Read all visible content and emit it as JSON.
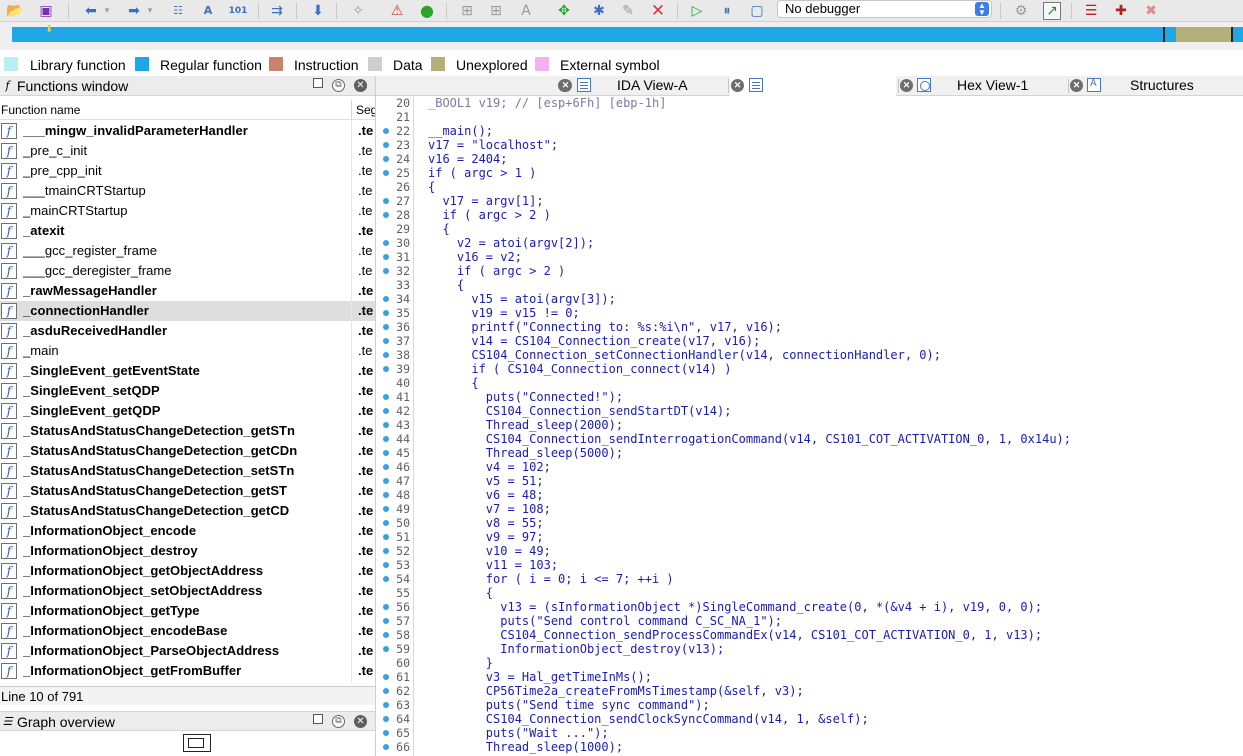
{
  "toolbar": {
    "debugger_select": "No debugger",
    "icons": [
      "open-icon",
      "save-icon",
      "back-icon",
      "forward-icon",
      "binary-icon",
      "text-icon",
      "hex-icon",
      "jump-icon",
      "download-icon",
      "search-icon",
      "warning-icon",
      "run-icon",
      "plus-icon",
      "graph-icon",
      "text-plus-icon",
      "tool-icon",
      "gear-icon",
      "edit-icon",
      "close-red-icon",
      "play-icon",
      "pause-icon",
      "stop-icon",
      "debug-icon",
      "terminal-icon",
      "stack-icon",
      "breakpoint-icon",
      "clear-breakpoint-icon"
    ]
  },
  "legend": [
    {
      "label": "Library function",
      "color": "#b7f0f4"
    },
    {
      "label": "Regular function",
      "color": "#1ea6e6"
    },
    {
      "label": "Instruction",
      "color": "#c9836a"
    },
    {
      "label": "Data",
      "color": "#cfcfcf"
    },
    {
      "label": "Unexplored",
      "color": "#b5b07a"
    },
    {
      "label": "External symbol",
      "color": "#f4b0f0"
    }
  ],
  "functions_window": {
    "title": "Functions window",
    "col_name": "Function name",
    "col_seg": "Seg",
    "selected_index": 9,
    "functions": [
      {
        "name": "___mingw_invalidParameterHandler",
        "seg": ".te",
        "bold": true
      },
      {
        "name": "_pre_c_init",
        "seg": ".te",
        "bold": false
      },
      {
        "name": "_pre_cpp_init",
        "seg": ".te",
        "bold": false
      },
      {
        "name": "___tmainCRTStartup",
        "seg": ".te",
        "bold": false
      },
      {
        "name": "_mainCRTStartup",
        "seg": ".te",
        "bold": false
      },
      {
        "name": "_atexit",
        "seg": ".te",
        "bold": true
      },
      {
        "name": "___gcc_register_frame",
        "seg": ".te",
        "bold": false
      },
      {
        "name": "___gcc_deregister_frame",
        "seg": ".te",
        "bold": false
      },
      {
        "name": "_rawMessageHandler",
        "seg": ".te",
        "bold": true
      },
      {
        "name": "_connectionHandler",
        "seg": ".te",
        "bold": true
      },
      {
        "name": "_asduReceivedHandler",
        "seg": ".te",
        "bold": true
      },
      {
        "name": "_main",
        "seg": ".te",
        "bold": false
      },
      {
        "name": "_SingleEvent_getEventState",
        "seg": ".te",
        "bold": true
      },
      {
        "name": "_SingleEvent_setQDP",
        "seg": ".te",
        "bold": true
      },
      {
        "name": "_SingleEvent_getQDP",
        "seg": ".te",
        "bold": true
      },
      {
        "name": "_StatusAndStatusChangeDetection_getSTn",
        "seg": ".te",
        "bold": true
      },
      {
        "name": "_StatusAndStatusChangeDetection_getCDn",
        "seg": ".te",
        "bold": true
      },
      {
        "name": "_StatusAndStatusChangeDetection_setSTn",
        "seg": ".te",
        "bold": true
      },
      {
        "name": "_StatusAndStatusChangeDetection_getST",
        "seg": ".te",
        "bold": true
      },
      {
        "name": "_StatusAndStatusChangeDetection_getCD",
        "seg": ".te",
        "bold": true
      },
      {
        "name": "_InformationObject_encode",
        "seg": ".te",
        "bold": true
      },
      {
        "name": "_InformationObject_destroy",
        "seg": ".te",
        "bold": true
      },
      {
        "name": "_InformationObject_getObjectAddress",
        "seg": ".te",
        "bold": true
      },
      {
        "name": "_InformationObject_setObjectAddress",
        "seg": ".te",
        "bold": true
      },
      {
        "name": "_InformationObject_getType",
        "seg": ".te",
        "bold": true
      },
      {
        "name": "_InformationObject_encodeBase",
        "seg": ".te",
        "bold": true
      },
      {
        "name": "_InformationObject_ParseObjectAddress",
        "seg": ".te",
        "bold": true
      },
      {
        "name": "_InformationObject_getFromBuffer",
        "seg": ".te",
        "bold": true
      }
    ],
    "status": "Line 10 of 791"
  },
  "graph_overview": {
    "title": "Graph overview"
  },
  "tabs": [
    {
      "label": "IDA View-A",
      "active": false,
      "icon": "ida-view-icon"
    },
    {
      "label": "",
      "active": true,
      "icon": "pseudocode-icon"
    },
    {
      "label": "Hex View-1",
      "active": false,
      "icon": "hex-view-icon"
    },
    {
      "label": "Structures",
      "active": false,
      "icon": "structures-icon"
    }
  ],
  "code_lines": [
    {
      "n": "20",
      "dot": false,
      "text": "_BOOL1 v19; // [esp+6Fh] [ebp-1h]"
    },
    {
      "n": "21",
      "dot": false,
      "text": ""
    },
    {
      "n": "22",
      "dot": true,
      "text": "__main();"
    },
    {
      "n": "23",
      "dot": true,
      "text": "v17 = \"localhost\";"
    },
    {
      "n": "24",
      "dot": true,
      "text": "v16 = 2404;"
    },
    {
      "n": "25",
      "dot": true,
      "text": "if ( argc > 1 )"
    },
    {
      "n": "26",
      "dot": false,
      "text": "{"
    },
    {
      "n": "27",
      "dot": true,
      "text": "  v17 = argv[1];"
    },
    {
      "n": "28",
      "dot": true,
      "text": "  if ( argc > 2 )"
    },
    {
      "n": "29",
      "dot": false,
      "text": "  {"
    },
    {
      "n": "30",
      "dot": true,
      "text": "    v2 = atoi(argv[2]);"
    },
    {
      "n": "31",
      "dot": true,
      "text": "    v16 = v2;"
    },
    {
      "n": "32",
      "dot": true,
      "text": "    if ( argc > 2 )"
    },
    {
      "n": "33",
      "dot": false,
      "text": "    {"
    },
    {
      "n": "34",
      "dot": true,
      "text": "      v15 = atoi(argv[3]);"
    },
    {
      "n": "35",
      "dot": true,
      "text": "      v19 = v15 != 0;"
    },
    {
      "n": "36",
      "dot": true,
      "text": "      printf(\"Connecting to: %s:%i\\n\", v17, v16);"
    },
    {
      "n": "37",
      "dot": true,
      "text": "      v14 = CS104_Connection_create(v17, v16);"
    },
    {
      "n": "38",
      "dot": true,
      "text": "      CS104_Connection_setConnectionHandler(v14, connectionHandler, 0);"
    },
    {
      "n": "39",
      "dot": true,
      "text": "      if ( CS104_Connection_connect(v14) )"
    },
    {
      "n": "40",
      "dot": false,
      "text": "      {"
    },
    {
      "n": "41",
      "dot": true,
      "text": "        puts(\"Connected!\");"
    },
    {
      "n": "42",
      "dot": true,
      "text": "        CS104_Connection_sendStartDT(v14);"
    },
    {
      "n": "43",
      "dot": true,
      "text": "        Thread_sleep(2000);"
    },
    {
      "n": "44",
      "dot": true,
      "text": "        CS104_Connection_sendInterrogationCommand(v14, CS101_COT_ACTIVATION_0, 1, 0x14u);"
    },
    {
      "n": "45",
      "dot": true,
      "text": "        Thread_sleep(5000);"
    },
    {
      "n": "46",
      "dot": true,
      "text": "        v4 = 102;"
    },
    {
      "n": "47",
      "dot": true,
      "text": "        v5 = 51;"
    },
    {
      "n": "48",
      "dot": true,
      "text": "        v6 = 48;"
    },
    {
      "n": "49",
      "dot": true,
      "text": "        v7 = 108;"
    },
    {
      "n": "50",
      "dot": true,
      "text": "        v8 = 55;"
    },
    {
      "n": "51",
      "dot": true,
      "text": "        v9 = 97;"
    },
    {
      "n": "52",
      "dot": true,
      "text": "        v10 = 49;"
    },
    {
      "n": "53",
      "dot": true,
      "text": "        v11 = 103;"
    },
    {
      "n": "54",
      "dot": true,
      "text": "        for ( i = 0; i <= 7; ++i )"
    },
    {
      "n": "55",
      "dot": false,
      "text": "        {"
    },
    {
      "n": "56",
      "dot": true,
      "text": "          v13 = (sInformationObject *)SingleCommand_create(0, *(&v4 + i), v19, 0, 0);"
    },
    {
      "n": "57",
      "dot": true,
      "text": "          puts(\"Send control command C_SC_NA_1\");"
    },
    {
      "n": "58",
      "dot": true,
      "text": "          CS104_Connection_sendProcessCommandEx(v14, CS101_COT_ACTIVATION_0, 1, v13);"
    },
    {
      "n": "59",
      "dot": true,
      "text": "          InformationObject_destroy(v13);"
    },
    {
      "n": "60",
      "dot": false,
      "text": "        }"
    },
    {
      "n": "61",
      "dot": true,
      "text": "        v3 = Hal_getTimeInMs();"
    },
    {
      "n": "62",
      "dot": true,
      "text": "        CP56Time2a_createFromMsTimestamp(&self, v3);"
    },
    {
      "n": "63",
      "dot": true,
      "text": "        puts(\"Send time sync command\");"
    },
    {
      "n": "64",
      "dot": true,
      "text": "        CS104_Connection_sendClockSyncCommand(v14, 1, &self);"
    },
    {
      "n": "65",
      "dot": true,
      "text": "        puts(\"Wait ...\");"
    },
    {
      "n": "66",
      "dot": true,
      "text": "        Thread_sleep(1000);"
    }
  ]
}
